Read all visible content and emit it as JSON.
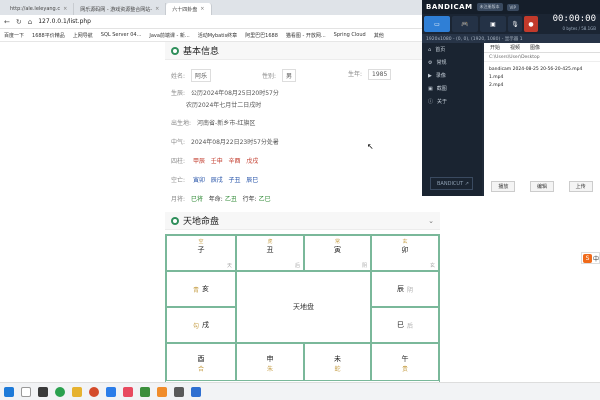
{
  "browser": {
    "tabs": [
      {
        "label": "http://ale.leleyang.c",
        "active": false
      },
      {
        "label": "网乐源码网 - 游戏资源整合网站-",
        "active": false
      },
      {
        "label": "六十四卦盘",
        "active": true
      }
    ],
    "url": "127.0.0.1/list.php",
    "bookmarks": [
      "百度一下",
      "1688平价精品",
      "上网导航",
      "SQL Server 04...",
      "Java前端课 - 新...",
      "活动Mybatis终章",
      "阿里巴巴1688",
      "猫看图 - 开放网...",
      "Spring Cloud",
      "其他"
    ]
  },
  "basic": {
    "section_title": "基本信息",
    "name_label": "姓名:",
    "name_value": "阿乐",
    "gender_label": "性别:",
    "gender_value": "男",
    "year_label": "生年:",
    "year_value": "1985",
    "birth_label": "生辰:",
    "birth_solar": "公历2024年08月25日20时57分",
    "birth_lunar": "农历2024年七月廿二日戌时",
    "place_label": "出生地:",
    "place_value": "河南省-新乡市-红旗区",
    "zhongqi_label": "中气:",
    "zhongqi_value": "2024年08月22日23时57分处暑",
    "pillars_label": "四柱:",
    "pillars": [
      "甲辰",
      "壬申",
      "辛酉",
      "戊戌"
    ],
    "kongwang_label": "空亡:",
    "kongwang": [
      "寅卯",
      "辰戌",
      "子丑",
      "辰巳"
    ],
    "monthly_label": "月将:",
    "monthly_value": "巳将",
    "year_gz_label": "年命:",
    "year_gz_value": "乙丑",
    "xingnian_label": "行年:",
    "xingnian_value": "乙巳"
  },
  "chart": {
    "section_title": "天地命盘",
    "center_label": "天地盘",
    "cells": [
      {
        "top": "空",
        "mid": "子",
        "bot": "天"
      },
      {
        "top": "虎",
        "mid": "丑",
        "bot": "后"
      },
      {
        "top": "常",
        "mid": "寅",
        "bot": "阴"
      },
      {
        "top": "玄",
        "mid": "卯",
        "bot": "玄"
      },
      {
        "top": "",
        "mid": "亥",
        "bot": "",
        "left": "青"
      },
      {
        "top": "",
        "mid": "辰",
        "bot": "",
        "right": "阴"
      },
      {
        "top": "",
        "mid": "戌",
        "bot": "",
        "left": "勾"
      },
      {
        "top": "",
        "mid": "巳",
        "bot": "",
        "right": "后"
      },
      {
        "top": "",
        "mid": "酉",
        "bot": "合"
      },
      {
        "top": "",
        "mid": "申",
        "bot": "朱"
      },
      {
        "top": "",
        "mid": "未",
        "bot": "蛇"
      },
      {
        "top": "",
        "mid": "午",
        "bot": "贵"
      }
    ]
  },
  "bandicam": {
    "logo": "BANDICAM",
    "badge1": "未注册版本",
    "badge2": "VIP",
    "mode_buttons": [
      "屏幕",
      "游戏",
      "设备"
    ],
    "timer": "00:00:00",
    "size": "0 bytes / 58.1GB",
    "resolution": "1920x1080 - (0, 0), (1920, 1080) - 显示器 1",
    "side_items": [
      "首页",
      "常规",
      "录像",
      "截图",
      "关于"
    ],
    "content_tabs": [
      "开始",
      "视频",
      "图像"
    ],
    "path": "C:\\Users\\User\\Desktop",
    "files": [
      "bandicam 2024-08-25 20-56-20-425.mp4",
      "1.mp4",
      "2.mp4"
    ],
    "bottom_buttons": [
      "播放",
      "编辑",
      "上传"
    ],
    "version": "BANDICUT ↗"
  },
  "sogou": "中"
}
